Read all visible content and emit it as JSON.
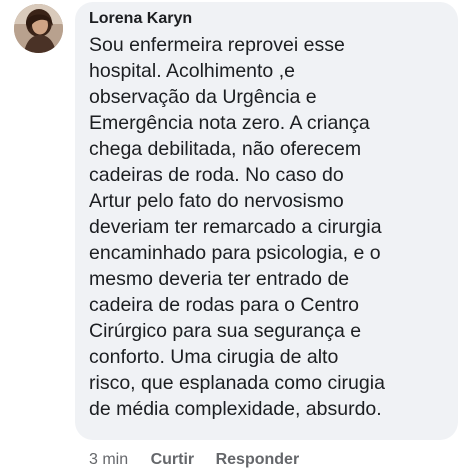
{
  "comment": {
    "author": "Lorena Karyn",
    "text_lines": [
      "Sou enfermeira reprovei esse",
      "hospital. Acolhimento ,e",
      "observação da Urgência e",
      "Emergência nota zero. A criança",
      "chega debilitada, não oferecem",
      "cadeiras de roda. No caso do",
      "Artur pelo fato do nervosismo",
      "deveriam ter remarcado a cirurgia",
      "encaminhado para psicologia, e o",
      "mesmo deveria ter entrado de",
      "cadeira de rodas para o Centro",
      "Cirúrgico para sua segurança e",
      "conforto. Uma cirugia de alto",
      "risco, que esplanada como cirugia",
      "de média complexidade, absurdo."
    ],
    "timestamp": "3 min",
    "actions": {
      "like_label": "Curtir",
      "reply_label": "Responder"
    }
  },
  "colors": {
    "bubble": "#f0f2f5",
    "text": "#1c1e21",
    "meta": "#65676b"
  },
  "icons": {
    "avatar": "profile-photo"
  }
}
